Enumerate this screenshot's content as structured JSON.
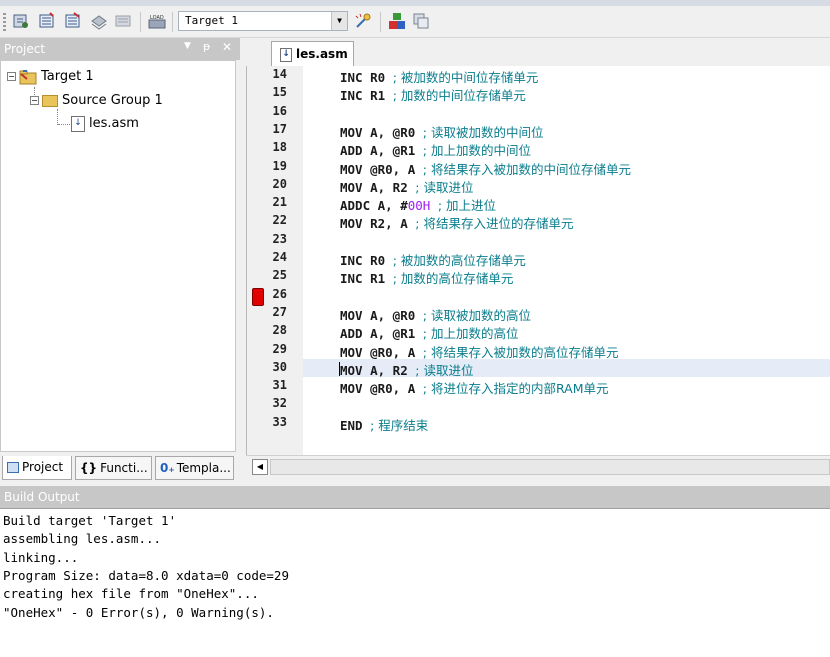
{
  "toolbar": {
    "target_combo": "Target 1",
    "icons": [
      "translate-icon",
      "build-icon",
      "rebuild-icon",
      "batch-build-icon",
      "stop-build-icon",
      "load-icon",
      "target-options-icon",
      "manage-components-icon",
      "select-packs-icon"
    ],
    "load_label": "LOAD"
  },
  "project_panel": {
    "title": "Project",
    "tree": {
      "target": "Target 1",
      "group": "Source Group 1",
      "file": "les.asm"
    },
    "tabs": [
      "Project",
      "Functi...",
      "Templa..."
    ]
  },
  "editor": {
    "tab": "les.asm",
    "breakpoint_line": 26,
    "cursor_line": 30,
    "lines": [
      {
        "n": "14",
        "code": "INC R0 ",
        "cmt": "; 被加数的中间位存储单元"
      },
      {
        "n": "15",
        "code": "INC R1 ",
        "cmt": "; 加数的中间位存储单元"
      },
      {
        "n": "16",
        "code": "",
        "cmt": ""
      },
      {
        "n": "17",
        "code": "MOV A, @R0 ",
        "cmt": "; 读取被加数的中间位"
      },
      {
        "n": "18",
        "code": "ADD A, @R1 ",
        "cmt": "; 加上加数的中间位"
      },
      {
        "n": "19",
        "code": "MOV @R0, A ",
        "cmt": "; 将结果存入被加数的中间位存储单元"
      },
      {
        "n": "20",
        "code": "MOV A, R2 ",
        "cmt": "; 读取进位"
      },
      {
        "n": "21",
        "code": "ADDC A, #",
        "num": "00H",
        "code2": " ",
        "cmt": "; 加上进位"
      },
      {
        "n": "22",
        "code": "MOV R2, A ",
        "cmt": "; 将结果存入进位的存储单元"
      },
      {
        "n": "23",
        "code": "",
        "cmt": ""
      },
      {
        "n": "24",
        "code": "INC R0 ",
        "cmt": "; 被加数的高位存储单元"
      },
      {
        "n": "25",
        "code": "INC R1 ",
        "cmt": "; 加数的高位存储单元"
      },
      {
        "n": "26",
        "code": "",
        "cmt": ""
      },
      {
        "n": "27",
        "code": "MOV A, @R0 ",
        "cmt": "; 读取被加数的高位"
      },
      {
        "n": "28",
        "code": "ADD A, @R1 ",
        "cmt": "; 加上加数的高位"
      },
      {
        "n": "29",
        "code": "MOV @R0, A ",
        "cmt": "; 将结果存入被加数的高位存储单元"
      },
      {
        "n": "30",
        "code": "MOV A, R2 ",
        "cmt": "; 读取进位"
      },
      {
        "n": "31",
        "code": "MOV @R0, A ",
        "cmt": "; 将进位存入指定的内部RAM单元"
      },
      {
        "n": "32",
        "code": "",
        "cmt": ""
      },
      {
        "n": "33",
        "code": "END ",
        "cmt": "; 程序结束"
      }
    ]
  },
  "build_output": {
    "title": "Build Output",
    "lines": [
      "Build target 'Target 1'",
      "assembling les.asm...",
      "linking...",
      "Program Size: data=8.0 xdata=0 code=29",
      "creating hex file from \"OneHex\"...",
      "\"OneHex\" - 0 Error(s), 0 Warning(s)."
    ]
  }
}
